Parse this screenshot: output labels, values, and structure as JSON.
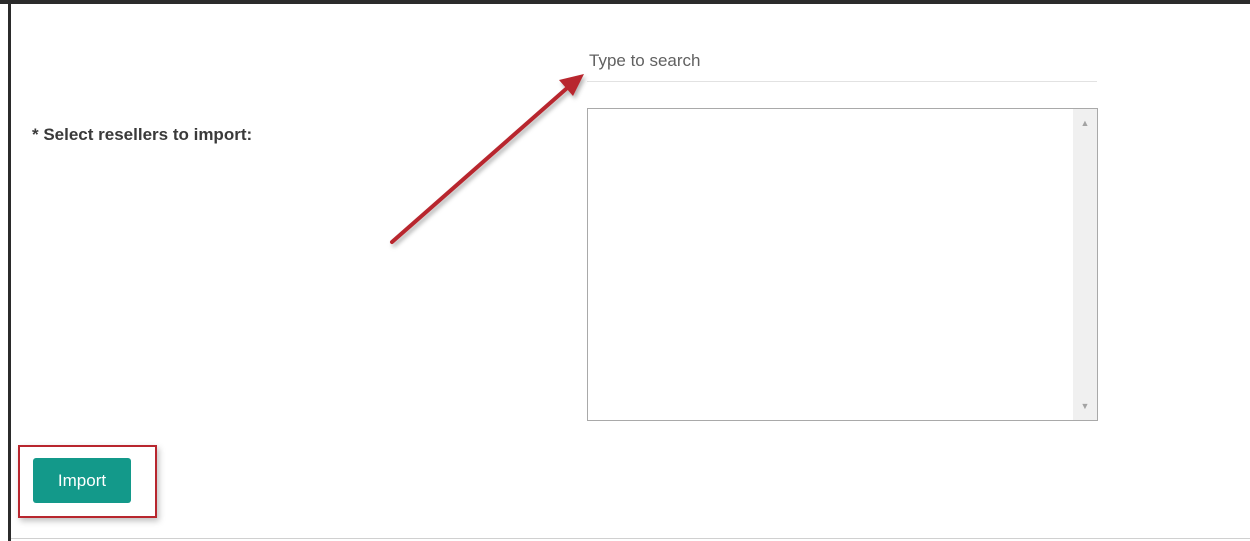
{
  "form": {
    "field_label": "* Select resellers to import:",
    "search_placeholder": "Type to search",
    "search_value": "",
    "resellers": [],
    "import_label": "Import"
  },
  "colors": {
    "primary_button": "#13998a",
    "annotation_red": "#b8262e"
  },
  "icons": {
    "scroll_up": "triangle-up",
    "scroll_down": "triangle-down"
  }
}
